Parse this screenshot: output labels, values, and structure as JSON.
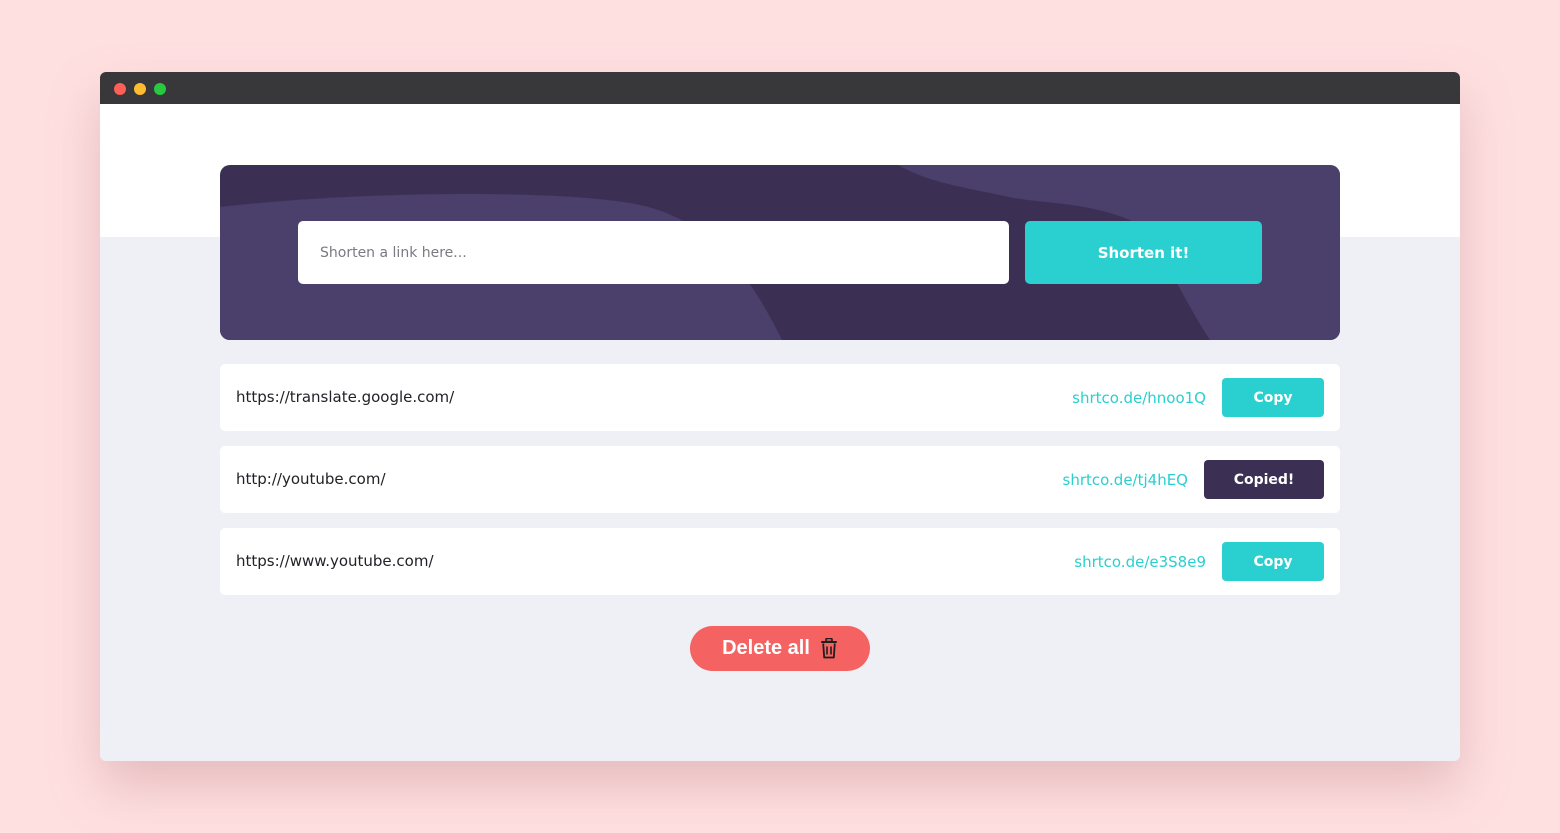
{
  "shortener": {
    "placeholder": "Shorten a link here...",
    "button_label": "Shorten it!"
  },
  "links": [
    {
      "original": "https://translate.google.com/",
      "short": "shrtco.de/hnoo1Q",
      "button": "Copy",
      "state": "default"
    },
    {
      "original": "http://youtube.com/",
      "short": "shrtco.de/tj4hEQ",
      "button": "Copied!",
      "state": "copied"
    },
    {
      "original": "https://www.youtube.com/",
      "short": "shrtco.de/e3S8e9",
      "button": "Copy",
      "state": "default"
    }
  ],
  "delete_all": {
    "label": "Delete all",
    "icon": "trash-icon"
  },
  "colors": {
    "background": "#ffe0e1",
    "cyan": "#2acfcf",
    "dark_violet": "#3b3054",
    "red": "#f46262",
    "grey_bg": "#eff0f5"
  }
}
